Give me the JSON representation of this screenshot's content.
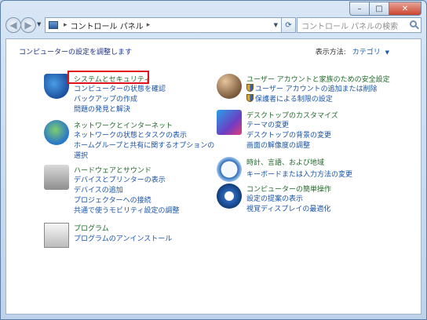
{
  "address": {
    "crumb": "コントロール パネル",
    "search_placeholder": "コントロール パネルの検索"
  },
  "content": {
    "heading": "コンピューターの設定を調整します",
    "view_by_label": "表示方法:",
    "view_by_value": "カテゴリ"
  },
  "categories": {
    "system": {
      "title": "システムとセキュリティ",
      "links": [
        "コンピューターの状態を確認",
        "バックアップの作成",
        "問題の発見と解決"
      ]
    },
    "network": {
      "title": "ネットワークとインターネット",
      "links": [
        "ネットワークの状態とタスクの表示",
        "ホームグループと共有に関するオプションの",
        "選択"
      ]
    },
    "hardware": {
      "title": "ハードウェアとサウンド",
      "links": [
        "デバイスとプリンターの表示",
        "デバイスの追加",
        "プロジェクターへの接続",
        "共通で使うモビリティ設定の調整"
      ]
    },
    "programs": {
      "title": "プログラム",
      "links": [
        "プログラムのアンインストール"
      ]
    },
    "users": {
      "title": "ユーザー アカウントと家族のための安全設定",
      "links": [
        "ユーザー アカウントの追加または削除",
        "保護者による制限の設定"
      ]
    },
    "appearance": {
      "title": "デスクトップのカスタマイズ",
      "links": [
        "テーマの変更",
        "デスクトップの背景の変更",
        "画面の解像度の調整"
      ]
    },
    "clock": {
      "title": "時計、言語、および地域",
      "links": [
        "キーボードまたは入力方法の変更"
      ]
    },
    "ease": {
      "title": "コンピューターの簡単操作",
      "links": [
        "設定の提案の表示",
        "視覚ディスプレイの最適化"
      ]
    }
  },
  "icons": {
    "back": "back-arrow-icon",
    "forward": "forward-arrow-icon",
    "refresh": "refresh-icon",
    "search": "search-icon",
    "shield": "uac-shield-icon"
  },
  "colors": {
    "category_title": "#1e6a28",
    "link": "#1a53a6",
    "highlight": "#e0131c"
  }
}
